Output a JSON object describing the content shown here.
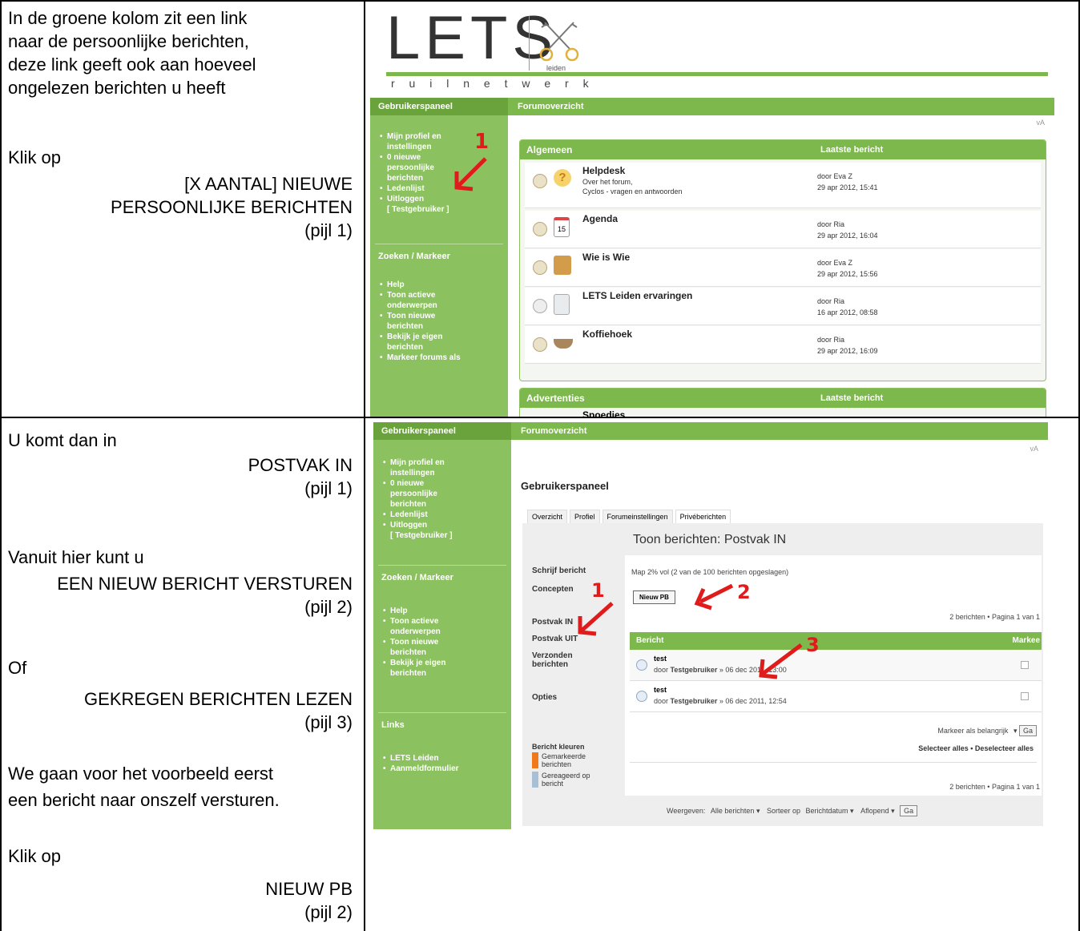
{
  "row1": {
    "text": {
      "intro": [
        "In de groene kolom zit een link",
        "naar de persoonlijke berichten,",
        "deze link geeft ook aan hoeveel",
        "ongelezen berichten u heeft"
      ],
      "klik": "Klik op",
      "target1": "[X AANTAL] NIEUWE",
      "target2": "PERSOONLIJKE BERICHTEN",
      "pijl": "(pijl 1)"
    },
    "screenshot": {
      "logo_letters": "LETS",
      "logo_sub": "leiden",
      "tagline": "r u i l n e t w e r k",
      "sidebar_head1": "Gebruikerspaneel",
      "sidebar_items1": [
        "Mijn profiel en",
        "instellingen",
        "0 nieuwe",
        "persoonlijke",
        "berichten",
        "Ledenlijst",
        "Uitloggen",
        "[ Testgebruiker ]"
      ],
      "sidebar_head2": "Zoeken / Markeer",
      "sidebar_items2": [
        "Help",
        "Toon actieve",
        "onderwerpen",
        "Toon nieuwe",
        "berichten",
        "Bekijk je eigen",
        "berichten",
        "Markeer forums als"
      ],
      "topbar": "Forumoverzicht",
      "corner": "vA",
      "arrow1": "1",
      "group1": "Algemeen",
      "group1_col": "Laatste bericht",
      "forums": [
        {
          "title": "Helpdesk",
          "sub1": "Over het forum,",
          "sub2": "Cyclos - vragen en antwoorden",
          "by": "door Eva Z",
          "date": "29 apr 2012, 15:41"
        },
        {
          "title": "Agenda",
          "sub1": "",
          "sub2": "",
          "by": "door Ria",
          "date": "29 apr 2012, 16:04"
        },
        {
          "title": "Wie is Wie",
          "sub1": "",
          "sub2": "",
          "by": "door Eva Z",
          "date": "29 apr 2012, 15:56"
        },
        {
          "title": "LETS Leiden ervaringen",
          "sub1": "",
          "sub2": "",
          "by": "door Ria",
          "date": "16 apr 2012, 08:58"
        },
        {
          "title": "Koffiehoek",
          "sub1": "",
          "sub2": "",
          "by": "door Ria",
          "date": "29 apr 2012, 16:09"
        }
      ],
      "agenda_day": "15",
      "group2": "Advertenties",
      "group2_col": "Laatste bericht",
      "group2_first": "Spoedjes"
    }
  },
  "row2": {
    "text": {
      "l1": "U komt dan in",
      "l2": "POSTVAK IN",
      "l3": "(pijl 1)",
      "l4": "Vanuit hier kunt u",
      "l5": "EEN NIEUW BERICHT VERSTUREN",
      "l6": "(pijl 2)",
      "l7": "Of",
      "l8": "GEKREGEN BERICHTEN LEZEN",
      "l9": "(pijl 3)",
      "l10": "We gaan voor het voorbeeld eerst",
      "l11": "een bericht naar onszelf versturen.",
      "l12": "Klik op",
      "l13": "NIEUW PB",
      "l14": "(pijl 2)"
    },
    "screenshot": {
      "sidebar_head1": "Gebruikerspaneel",
      "sidebar_items1": [
        "Mijn profiel en",
        "instellingen",
        "0 nieuwe",
        "persoonlijke",
        "berichten",
        "Ledenlijst",
        "Uitloggen",
        "[ Testgebruiker ]"
      ],
      "sidebar_head2": "Zoeken / Markeer",
      "sidebar_items2": [
        "Help",
        "Toon actieve",
        "onderwerpen",
        "Toon nieuwe",
        "berichten",
        "Bekijk je eigen",
        "berichten"
      ],
      "sidebar_head3": "Links",
      "sidebar_items3": [
        "LETS Leiden",
        "Aanmeldformulier"
      ],
      "topbar": "Forumoverzicht",
      "corner": "vA",
      "panel_title": "Gebruikerspaneel",
      "tabs": [
        "Overzicht",
        "Profiel",
        "Forumeinstellingen",
        "Privéberichten"
      ],
      "heading": "Toon berichten: Postvak IN",
      "menu": [
        "Schrijf bericht",
        "Concepten",
        "Postvak IN",
        "Postvak UIT",
        "Verzonden",
        "berichten",
        "Opties"
      ],
      "folder_info": "Map 2% vol (2 van de 100 berichten opgeslagen)",
      "new_pm": "Nieuw PB",
      "pagination": "2 berichten • Pagina 1 van 1",
      "col_bericht": "Bericht",
      "col_markeer": "Markee",
      "messages": [
        {
          "title": "test",
          "by": "door",
          "user": "Testgebruiker",
          "date": "» 06 dec 2011, 13:00"
        },
        {
          "title": "test",
          "by": "door",
          "user": "Testgebruiker",
          "date": "» 06 dec 2011, 12:54"
        }
      ],
      "mark_select": "Markeer als belangrijk",
      "go": "Ga",
      "select_all": "Selecteer alles • Deselecteer alles",
      "color_head": "Bericht kleuren",
      "color1": [
        "Gemarkeerde",
        "berichten"
      ],
      "color2": [
        "Gereageerd op",
        "bericht"
      ],
      "filter_label": "Weergeven:",
      "filter_all": "Alle berichten",
      "sort_label": "Sorteer op",
      "sort_field": "Berichtdatum",
      "sort_dir": "Aflopend",
      "arrow1": "1",
      "arrow2": "2",
      "arrow3": "3"
    }
  }
}
